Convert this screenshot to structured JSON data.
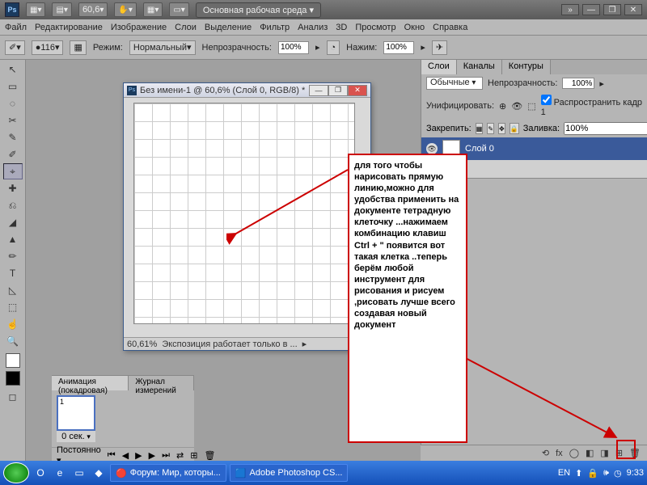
{
  "app": {
    "logo": "Ps",
    "zoom_top": "60,6",
    "workspace_btn": "Основная рабочая среда"
  },
  "menu": [
    "Файл",
    "Редактирование",
    "Изображение",
    "Слои",
    "Выделение",
    "Фильтр",
    "Анализ",
    "3D",
    "Просмотр",
    "Окно",
    "Справка"
  ],
  "optbar": {
    "brush_size": "116",
    "mode_label": "Режим:",
    "mode_value": "Нормальный",
    "opacity_label": "Непрозрачность:",
    "opacity_value": "100%",
    "flow_label": "Нажим:",
    "flow_value": "100%"
  },
  "docwin": {
    "title": "Без имени-1 @ 60,6% (Слой 0, RGB/8) *",
    "status_zoom": "60,61%",
    "status_text": "Экспозиция работает только в ..."
  },
  "layers_panel": {
    "tabs": [
      "Слои",
      "Каналы",
      "Контуры"
    ],
    "blend": "Обычные",
    "opacity_label": "Непрозрачность:",
    "opacity": "100%",
    "unify_label": "Унифицировать:",
    "propagate": "Распространить кадр 1",
    "lock_label": "Закрепить:",
    "fill_label": "Заливка:",
    "fill": "100%",
    "layer0": "Слой 0"
  },
  "anim": {
    "tabs": [
      "Анимация (покадровая)",
      "Журнал измерений"
    ],
    "frame_num": "1",
    "frame_time": "0 сек.",
    "loop": "Постоянно"
  },
  "annotation": "для того чтобы нарисовать прямую линию,можно для удобства применить на документе тетрадную клеточку ...нажимаем комбинацию клавиш Ctrl + \" появится вот такая клетка ..теперь берём любой инструмент для рисования и рисуем ,рисовать лучше всего создавая новый документ",
  "taskbar": {
    "btn1": "Форум: Мир, которы...",
    "btn2": "Adobe Photoshop CS...",
    "lang": "EN",
    "time": "9:33"
  },
  "tools": [
    "↖",
    "▭",
    "◌",
    "✂",
    "✎",
    "✐",
    "⌖",
    "✚",
    "⎌",
    "◢",
    "▲",
    "✏",
    "T",
    "◺",
    "⬚",
    "☝",
    "🔍",
    "⊕",
    "⊖"
  ],
  "footicons": [
    "⟲",
    "fx",
    "◯",
    "◧",
    "◨",
    "⊞",
    "🗑"
  ]
}
